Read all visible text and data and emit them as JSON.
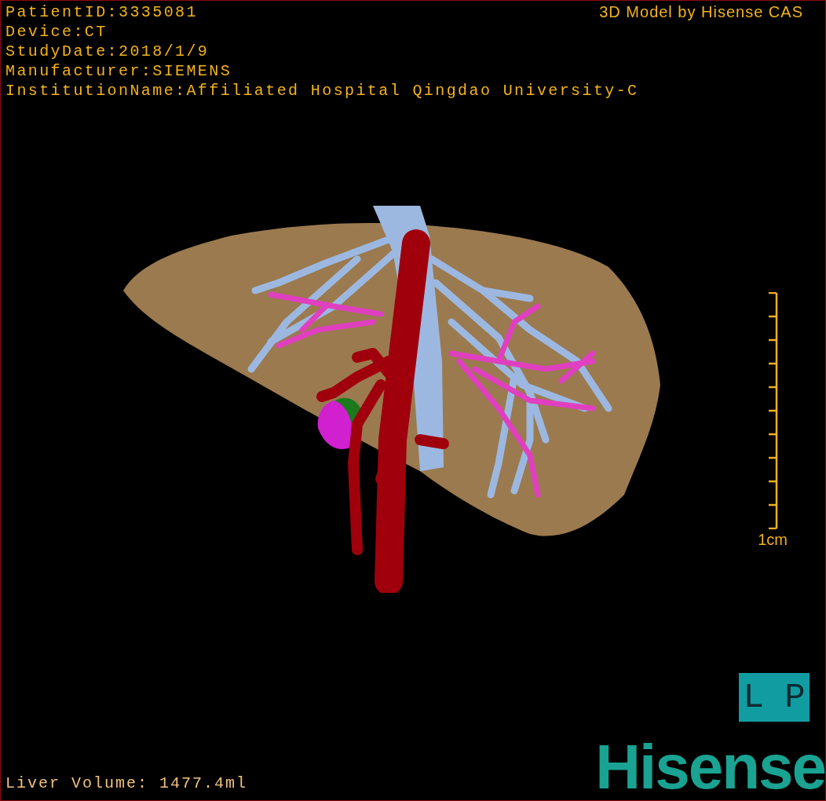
{
  "info_lines": [
    "PatientID:3335081",
    "Device:CT",
    "StudyDate:2018/1/9",
    "Manufacturer:SIEMENS",
    "InstitutionName:Affiliated Hospital Qingdao University-C"
  ],
  "model_credit": "3D Model by Hisense CAS",
  "scale": {
    "label": "1cm"
  },
  "orientation": "L P",
  "liver_volume": "Liver Volume: 1477.4ml",
  "logo": "Hisense"
}
